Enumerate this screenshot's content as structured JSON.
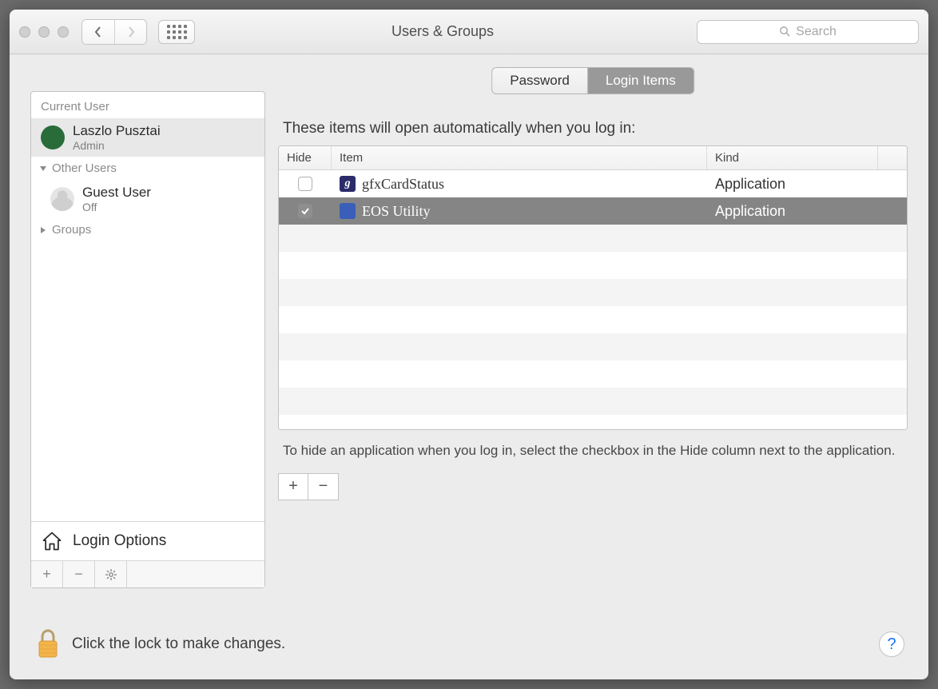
{
  "window": {
    "title": "Users & Groups"
  },
  "search": {
    "placeholder": "Search"
  },
  "sidebar": {
    "current_label": "Current User",
    "current_user": {
      "name": "Laszlo Pusztai",
      "role": "Admin"
    },
    "other_label": "Other Users",
    "guest": {
      "name": "Guest User",
      "status": "Off"
    },
    "groups_label": "Groups",
    "login_options_label": "Login Options"
  },
  "tabs": {
    "password": "Password",
    "login_items": "Login Items"
  },
  "main": {
    "description": "These items will open automatically when you log in:",
    "columns": {
      "hide": "Hide",
      "item": "Item",
      "kind": "Kind"
    },
    "rows": [
      {
        "hide": false,
        "name": "gfxCardStatus",
        "kind": "Application",
        "icon": "g"
      },
      {
        "hide": true,
        "name": "EOS Utility",
        "kind": "Application",
        "icon": "cam"
      }
    ],
    "hint": "To hide an application when you log in, select the checkbox in the Hide column next to the application."
  },
  "footer": {
    "lock_text": "Click the lock to make changes."
  }
}
